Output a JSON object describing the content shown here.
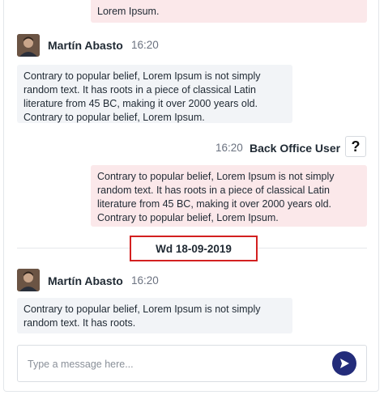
{
  "messages": {
    "top_partial": {
      "line1": "",
      "line2": "Lorem Ipsum."
    },
    "incoming_1": {
      "sender": "Martín Abasto",
      "time": "16:20",
      "text": "Contrary to popular belief, Lorem Ipsum is not simply random text. It has roots in a piece of classical Latin literature from 45 BC, making it over 2000 years old. Contrary to popular belief, Lorem Ipsum."
    },
    "outgoing_1": {
      "sender": "Back Office User",
      "time": "16:20",
      "help_label": "?",
      "text": "Contrary to popular belief, Lorem Ipsum is not simply random text. It has roots in a piece of classical Latin literature from 45 BC, making it over 2000 years old. Contrary to popular belief, Lorem Ipsum."
    },
    "date_separator": "Wd 18-09-2019",
    "incoming_2": {
      "sender": "Martín Abasto",
      "time": "16:20",
      "text": "Contrary to popular belief, Lorem Ipsum is not simply random text. It has roots."
    }
  },
  "composer": {
    "placeholder": "Type a message here...",
    "value": ""
  },
  "colors": {
    "incoming_bubble": "#f2f4f7",
    "outgoing_bubble": "#fbe8ea",
    "send_button": "#232c7a",
    "date_highlight_border": "#d32020"
  },
  "icons": {
    "send": "send-arrow-icon",
    "avatar": "user-avatar"
  }
}
